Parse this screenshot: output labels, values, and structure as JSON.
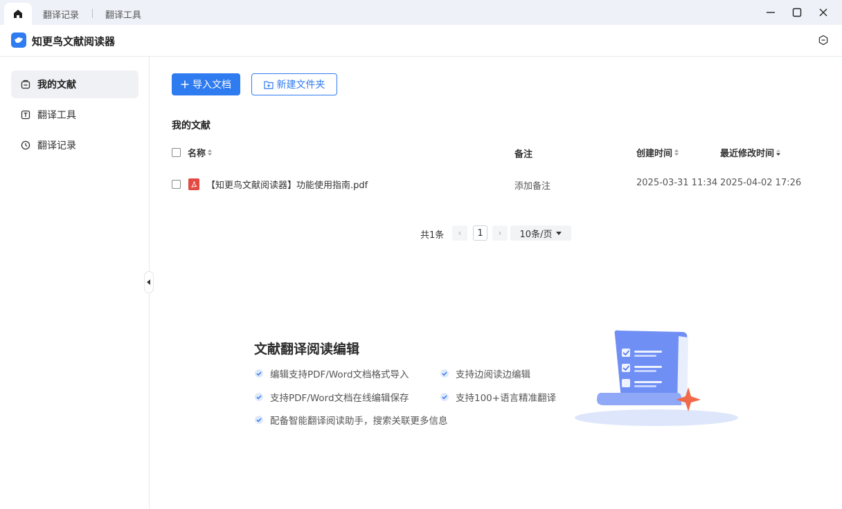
{
  "tabs": {
    "home_icon": "home-icon",
    "items": [
      "翻译记录",
      "翻译工具"
    ]
  },
  "window": {
    "minimize_icon": "minimize-icon",
    "maximize_icon": "maximize-icon",
    "close_icon": "close-icon"
  },
  "app": {
    "title": "知更鸟文献阅读器",
    "logo_icon": "bird-logo-icon",
    "settings_icon": "hexagon-settings-icon"
  },
  "sidebar": {
    "items": [
      {
        "label": "我的文献",
        "icon": "library-icon",
        "active": true
      },
      {
        "label": "翻译工具",
        "icon": "translate-icon",
        "active": false
      },
      {
        "label": "翻译记录",
        "icon": "clock-icon",
        "active": false
      }
    ]
  },
  "toolbar": {
    "import_label": "导入文档",
    "new_folder_label": "新建文件夹"
  },
  "section_title": "我的文献",
  "table": {
    "headers": {
      "name": "名称",
      "note": "备注",
      "created": "创建时间",
      "modified": "最近修改时间"
    },
    "rows": [
      {
        "name": "【知更鸟文献阅读器】功能使用指南.pdf",
        "note": "添加备注",
        "created": "2025-03-31 11:34",
        "modified": "2025-04-02 17:26"
      }
    ]
  },
  "pager": {
    "total": "共1条",
    "prev": "‹",
    "page": "1",
    "next": "›",
    "page_size": "10条/页"
  },
  "promo": {
    "title": "文献翻译阅读编辑",
    "features": [
      "编辑支持PDF/Word文档格式导入",
      "支持边阅读边编辑",
      "支持PDF/Word文档在线编辑保存",
      "支持100+语言精准翻译",
      "配备智能翻译阅读助手，搜索关联更多信息"
    ]
  },
  "colors": {
    "accent": "#2f7bf0",
    "pdf": "#e24a42",
    "titlebar": "#eef1f7"
  }
}
